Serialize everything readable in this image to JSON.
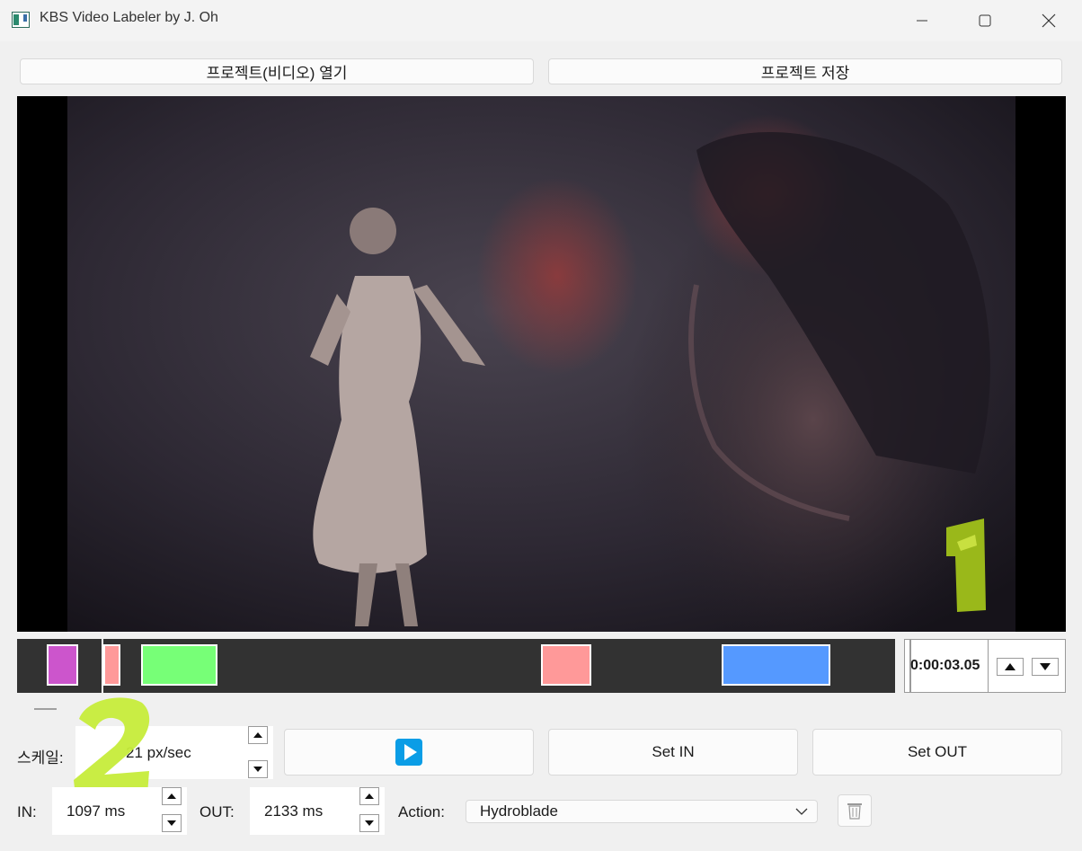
{
  "window": {
    "title": "KBS Video Labeler by J. Oh",
    "icons": [
      "app-icon",
      "minimize-icon",
      "maximize-icon",
      "close-icon"
    ]
  },
  "toolbar": {
    "open_label": "프로젝트(비디오) 열기",
    "save_label": "프로젝트 저장"
  },
  "overlay_marks": {
    "mark1": "1",
    "mark2": "2"
  },
  "timeline": {
    "segment_colors": [
      "#cc55cc",
      "#ff9999",
      "#77ff77",
      "#ff9999",
      "#5599ff"
    ],
    "time": "0:00:03.05",
    "up_icon": "triangle-up-icon",
    "down_icon": "triangle-down-icon"
  },
  "controls": {
    "scale_label": "스케일:",
    "scale_value": "21 px/sec",
    "play_icon": "play-icon",
    "set_in_label": "Set IN",
    "set_out_label": "Set OUT"
  },
  "labels": {
    "in_label": "IN:",
    "in_value": "1097 ms",
    "out_label": "OUT:",
    "out_value": "2133 ms",
    "action_label": "Action:",
    "action_value": "Hydroblade",
    "delete_icon": "trash-icon"
  }
}
